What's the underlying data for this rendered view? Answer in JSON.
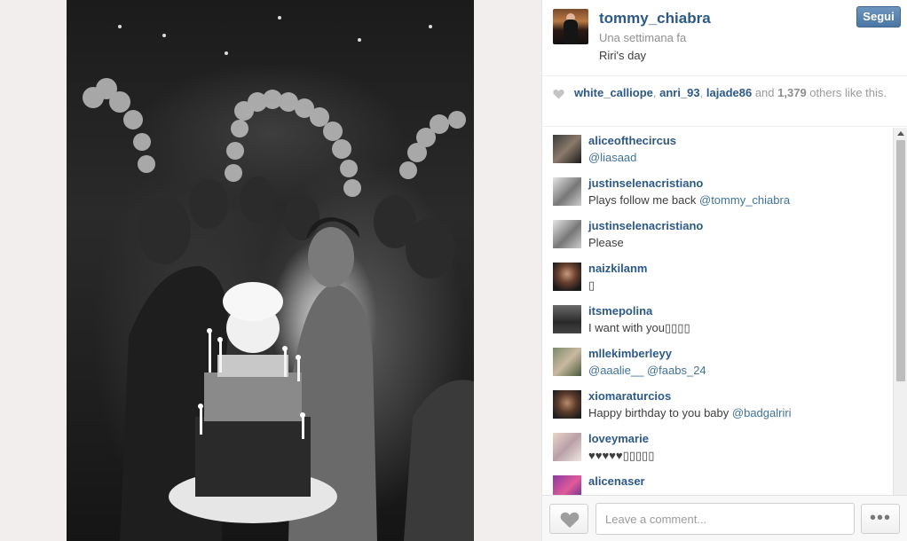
{
  "post": {
    "username": "tommy_chiabra",
    "time": "Una settimana fa",
    "caption": "Riri's day",
    "follow_label": "Segui"
  },
  "likes": {
    "users": [
      "white_calliope",
      "anri_93",
      "lajade86"
    ],
    "sep1": ", ",
    "sep2": ", ",
    "and": " and ",
    "count": "1,379",
    "suffix": " others like this."
  },
  "comments": [
    {
      "user": "aliceofthecircus",
      "text": "",
      "mention": "@liasaad"
    },
    {
      "user": "justinselenacristiano",
      "text": "Plays follow me back ",
      "mention": "@tommy_chiabra"
    },
    {
      "user": "justinselenacristiano",
      "text": "Please",
      "mention": ""
    },
    {
      "user": "naizkilanm",
      "text": "▯",
      "mention": ""
    },
    {
      "user": "itsmepolina",
      "text": "I want with you▯▯▯▯",
      "mention": ""
    },
    {
      "user": "mllekimberleyy",
      "text": "",
      "mention": "@aaalie__ @faabs_24"
    },
    {
      "user": "xiomaraturcios",
      "text": "Happy birthday to you baby ",
      "mention": "@badgalriri"
    },
    {
      "user": "loveymarie",
      "text": "♥♥♥♥♥▯▯▯▯▯",
      "mention": ""
    },
    {
      "user": "alicenaser",
      "text": "",
      "mention": ""
    }
  ],
  "footer": {
    "placeholder": "Leave a comment...",
    "more_label": "•••"
  },
  "icons": {
    "like": "heart-icon",
    "more": "more-dots-icon",
    "scroll": "scroll-up-arrow-icon"
  },
  "colors": {
    "link": "#2c5987",
    "mention": "#3f729b",
    "follow_button": "#4b76a4"
  }
}
